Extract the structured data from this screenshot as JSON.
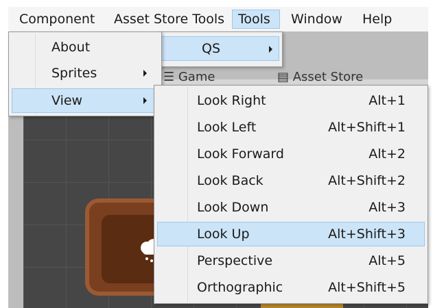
{
  "menubar": {
    "items": [
      {
        "label": "Component"
      },
      {
        "label": "Asset Store Tools"
      },
      {
        "label": "Tools"
      },
      {
        "label": "Window"
      },
      {
        "label": "Help"
      }
    ]
  },
  "editor": {
    "tabs": [
      {
        "label": "Game"
      },
      {
        "label": "Asset Store"
      }
    ]
  },
  "tools_menu": {
    "items": [
      {
        "label": "QS",
        "has_submenu": true
      }
    ]
  },
  "qs_menu": {
    "items": [
      {
        "label": "About"
      },
      {
        "label": "Sprites",
        "has_submenu": true
      },
      {
        "label": "View",
        "has_submenu": true
      }
    ]
  },
  "view_menu": {
    "items": [
      {
        "label": "Look Right",
        "shortcut": "Alt+1"
      },
      {
        "label": "Look Left",
        "shortcut": "Alt+Shift+1"
      },
      {
        "label": "Look Forward",
        "shortcut": "Alt+2"
      },
      {
        "label": "Look Back",
        "shortcut": "Alt+Shift+2"
      },
      {
        "label": "Look Down",
        "shortcut": "Alt+3"
      },
      {
        "label": "Look Up",
        "shortcut": "Alt+Shift+3"
      },
      {
        "label": "Perspective",
        "shortcut": "Alt+5"
      },
      {
        "label": "Orthographic",
        "shortcut": "Alt+Shift+5"
      }
    ]
  },
  "colors": {
    "highlight": "#cce4f7",
    "highlight_border": "#99c8f0",
    "menu_bg": "#f0f0f0"
  }
}
